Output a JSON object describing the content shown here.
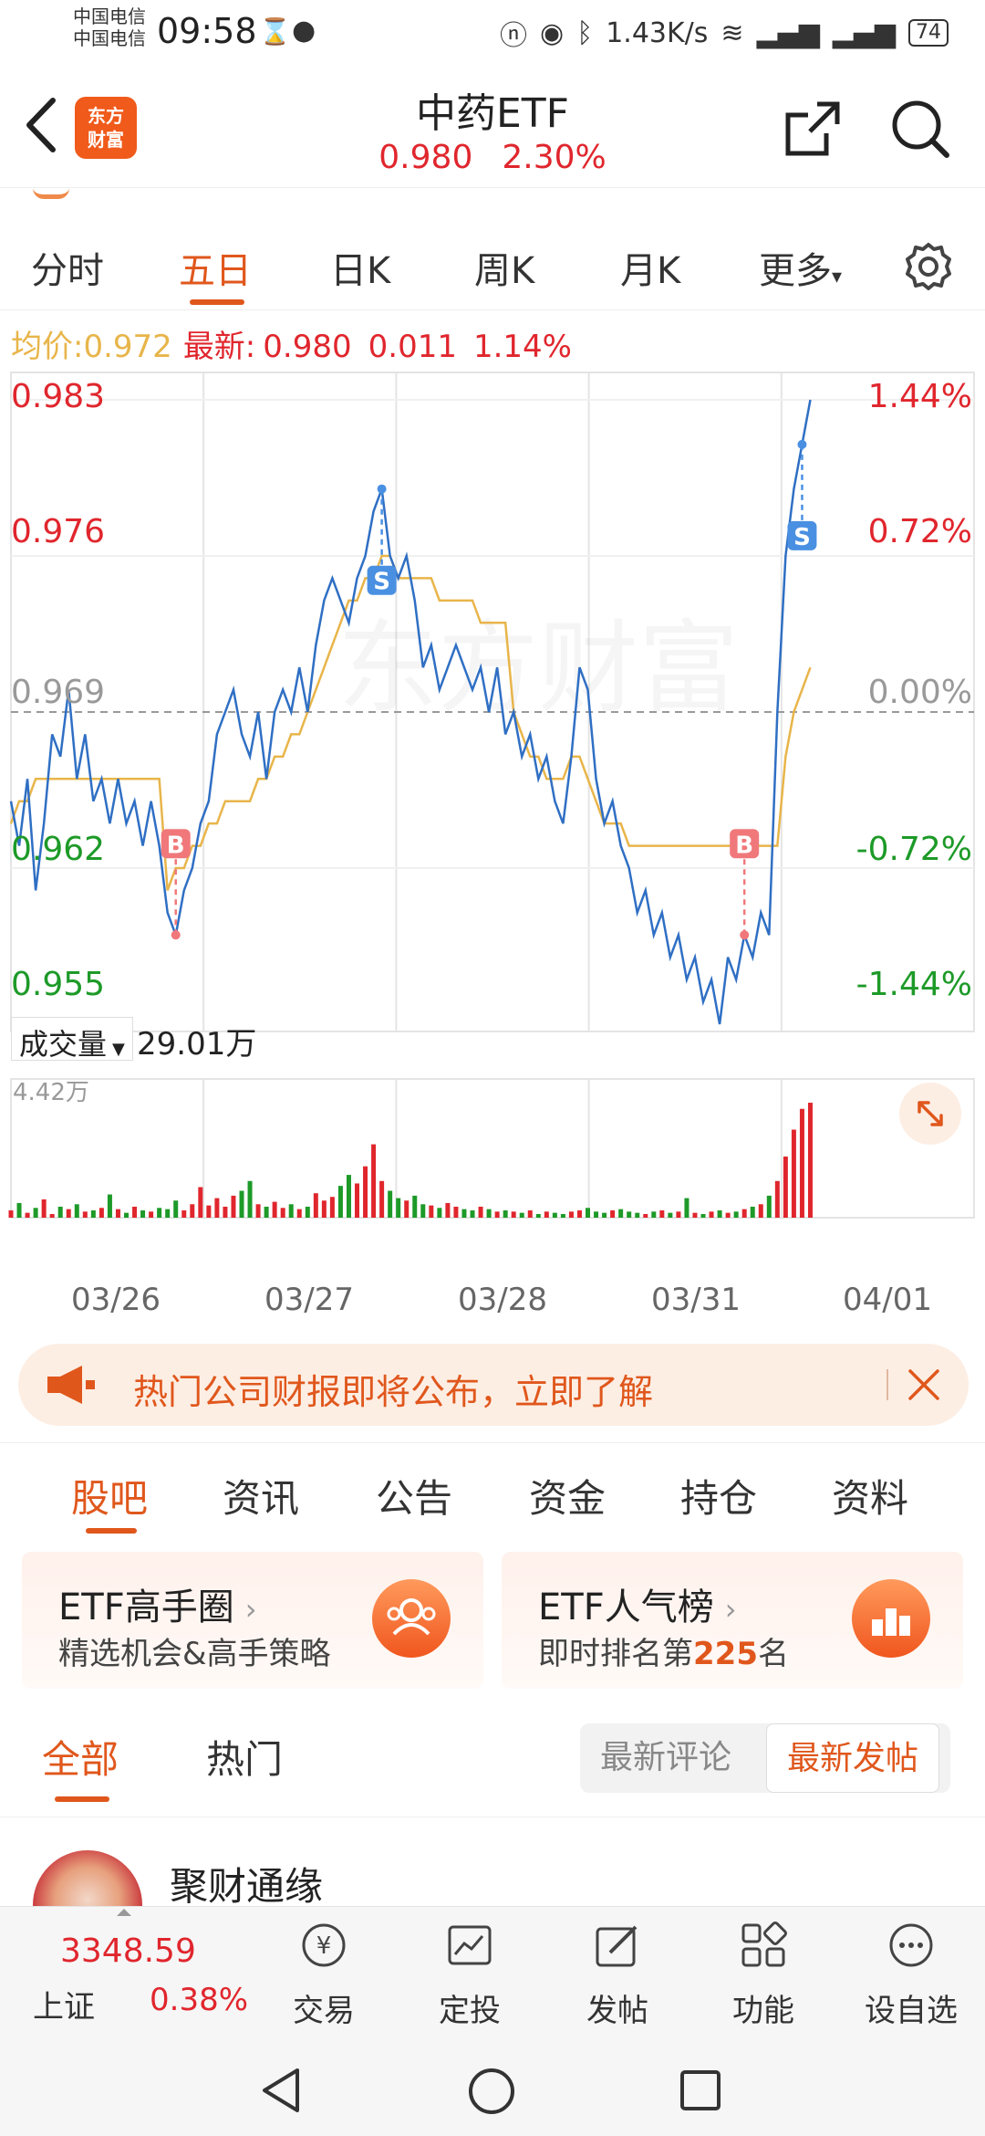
{
  "status_bar": {
    "carrier1": "中国电信",
    "carrier2": "中国电信",
    "time": "09:58",
    "net_speed": "1.43K/s",
    "battery": "74"
  },
  "header": {
    "title": "中药ETF",
    "price": "0.980",
    "change_pct": "2.30%",
    "logo_line1": "东方",
    "logo_line2": "财富"
  },
  "chart_tabs": [
    "分时",
    "五日",
    "日K",
    "周K",
    "月K",
    "更多"
  ],
  "active_chart_tab": "五日",
  "info_line": {
    "avg_label": "均价:",
    "avg_value": "0.972",
    "latest_label": "最新:",
    "latest_value": "0.980",
    "change": "0.011",
    "change_pct": "1.14%"
  },
  "chart_data": {
    "type": "line",
    "y_left_ticks": [
      "0.983",
      "0.976",
      "0.969",
      "0.962",
      "0.955"
    ],
    "y_right_ticks": [
      "1.44%",
      "0.72%",
      "0.00%",
      "-0.72%",
      "-1.44%"
    ],
    "x_labels": [
      "03/26",
      "03/27",
      "03/28",
      "03/31",
      "04/01"
    ],
    "ylim": [
      0.955,
      0.983
    ],
    "reference_price": 0.969,
    "price": [
      0.965,
      0.963,
      0.966,
      0.961,
      0.964,
      0.968,
      0.967,
      0.97,
      0.966,
      0.968,
      0.965,
      0.966,
      0.964,
      0.966,
      0.964,
      0.965,
      0.963,
      0.965,
      0.963,
      0.96,
      0.959,
      0.961,
      0.962,
      0.964,
      0.965,
      0.968,
      0.969,
      0.97,
      0.968,
      0.967,
      0.969,
      0.966,
      0.969,
      0.97,
      0.969,
      0.971,
      0.969,
      0.972,
      0.974,
      0.975,
      0.974,
      0.973,
      0.975,
      0.976,
      0.978,
      0.979,
      0.976,
      0.975,
      0.976,
      0.974,
      0.971,
      0.972,
      0.97,
      0.971,
      0.972,
      0.971,
      0.97,
      0.971,
      0.969,
      0.971,
      0.968,
      0.969,
      0.967,
      0.968,
      0.966,
      0.967,
      0.965,
      0.964,
      0.967,
      0.971,
      0.97,
      0.966,
      0.964,
      0.965,
      0.963,
      0.962,
      0.96,
      0.961,
      0.959,
      0.96,
      0.958,
      0.959,
      0.957,
      0.958,
      0.956,
      0.957,
      0.955,
      0.958,
      0.957,
      0.959,
      0.958,
      0.96,
      0.959,
      0.969,
      0.976,
      0.979,
      0.981,
      0.983
    ],
    "average": [
      0.964,
      0.965,
      0.965,
      0.966,
      0.966,
      0.966,
      0.966,
      0.966,
      0.966,
      0.966,
      0.966,
      0.966,
      0.966,
      0.966,
      0.966,
      0.966,
      0.966,
      0.966,
      0.966,
      0.961,
      0.962,
      0.962,
      0.963,
      0.963,
      0.964,
      0.964,
      0.965,
      0.965,
      0.965,
      0.965,
      0.966,
      0.966,
      0.967,
      0.967,
      0.968,
      0.968,
      0.969,
      0.97,
      0.971,
      0.972,
      0.973,
      0.974,
      0.974,
      0.975,
      0.975,
      0.976,
      0.976,
      0.975,
      0.975,
      0.975,
      0.975,
      0.975,
      0.974,
      0.974,
      0.974,
      0.974,
      0.974,
      0.973,
      0.973,
      0.973,
      0.973,
      0.969,
      0.968,
      0.967,
      0.967,
      0.966,
      0.966,
      0.966,
      0.967,
      0.967,
      0.966,
      0.965,
      0.964,
      0.964,
      0.964,
      0.963,
      0.963,
      0.963,
      0.963,
      0.963,
      0.963,
      0.963,
      0.963,
      0.963,
      0.963,
      0.963,
      0.963,
      0.963,
      0.963,
      0.963,
      0.963,
      0.963,
      0.963,
      0.963,
      0.967,
      0.969,
      0.97,
      0.971
    ],
    "markers": [
      {
        "label": "B",
        "index": 20
      },
      {
        "label": "S",
        "index": 45
      },
      {
        "label": "B",
        "index": 89
      },
      {
        "label": "S",
        "index": 96
      }
    ],
    "volume_label": "成交量",
    "volume_value": "29.01万",
    "volume_max_label": "4.42万",
    "volume": [
      0.6,
      1.2,
      0.4,
      0.8,
      1.5,
      0.3,
      0.9,
      0.7,
      1.1,
      0.5,
      0.6,
      0.8,
      1.9,
      0.7,
      0.4,
      0.9,
      0.6,
      0.5,
      0.8,
      0.7,
      1.4,
      0.6,
      1.1,
      2.5,
      1.0,
      1.6,
      0.9,
      1.8,
      2.2,
      3.0,
      1.1,
      0.9,
      1.3,
      0.8,
      1.1,
      0.7,
      0.9,
      2.0,
      1.4,
      1.7,
      2.6,
      3.5,
      2.8,
      4.2,
      6.0,
      3.0,
      2.2,
      1.6,
      1.4,
      1.8,
      1.1,
      1.0,
      0.8,
      1.2,
      0.9,
      0.7,
      0.6,
      0.9,
      0.7,
      0.5,
      0.6,
      0.5,
      0.4,
      0.6,
      0.3,
      0.5,
      0.4,
      0.3,
      0.5,
      0.6,
      0.8,
      0.5,
      0.4,
      0.6,
      0.7,
      0.5,
      0.4,
      0.3,
      0.5,
      0.6,
      0.4,
      0.5,
      1.6,
      0.4,
      0.3,
      0.5,
      0.6,
      0.4,
      0.5,
      0.7,
      0.9,
      1.1,
      1.8,
      3.0,
      5.0,
      7.2,
      8.9,
      9.4
    ],
    "volume_max": 10
  },
  "banner": {
    "text": "热门公司财报即将公布，立即了解"
  },
  "section_tabs": [
    "股吧",
    "资讯",
    "公告",
    "资金",
    "持仓",
    "资料"
  ],
  "active_section_tab": "股吧",
  "cards": [
    {
      "title": "ETF高手圈",
      "subtitle": "精选机会&高手策略"
    },
    {
      "title": "ETF人气榜",
      "subtitle_prefix": "即时排名第",
      "rank": "225",
      "subtitle_suffix": "名"
    }
  ],
  "filter": {
    "tabs": [
      "全部",
      "热门"
    ],
    "active_tab": "全部",
    "sort_options": [
      "最新评论",
      "最新发帖"
    ],
    "active_sort": "最新发帖"
  },
  "post": {
    "username": "聚财通缘"
  },
  "bottom_bar": {
    "index_value": "3348.59",
    "index_name": "上证",
    "index_change": "0.38%",
    "items": [
      "交易",
      "定投",
      "发帖",
      "功能",
      "设自选"
    ]
  },
  "colors": {
    "up": "#e0262d",
    "down": "#1d9a28",
    "accent": "#e0571c",
    "price_line": "#2f6fc4",
    "avg_line": "#e8b54a"
  }
}
